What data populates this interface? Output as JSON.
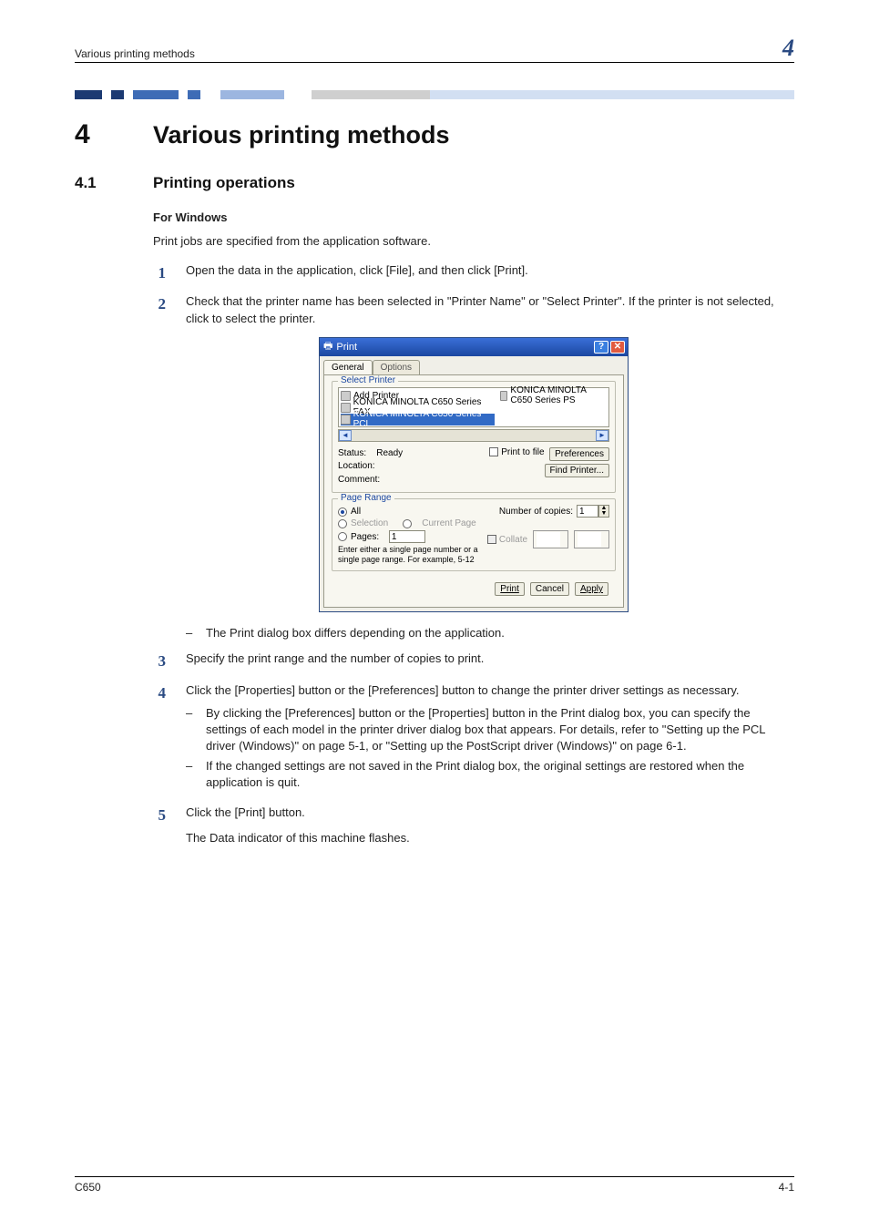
{
  "runhead": {
    "title": "Various printing methods",
    "num": "4"
  },
  "chapter": {
    "num": "4",
    "title": "Various printing methods"
  },
  "section": {
    "num": "4.1",
    "title": "Printing operations"
  },
  "sub_title": "For Windows",
  "intro_para": "Print jobs are specified from the application software.",
  "steps": {
    "s1": {
      "num": "1",
      "text": "Open the data in the application, click [File], and then click [Print]."
    },
    "s2": {
      "num": "2",
      "text": "Check that the printer name has been selected in \"Printer Name\" or \"Select Printer\". If the printer is not selected, click to select the printer."
    },
    "post2_dash": "The Print dialog box differs depending on the application.",
    "s3": {
      "num": "3",
      "text": "Specify the print range and the number of copies to print."
    },
    "s4": {
      "num": "4",
      "text": "Click the [Properties] button or the [Preferences] button to change the printer driver settings as necessary.",
      "d1": "By clicking the [Preferences] button or the [Properties] button in the Print dialog box, you can specify the settings of each model in the printer driver dialog box that appears. For details, refer to \"Setting up the PCL driver (Windows)\" on page 5-1, or \"Setting up the PostScript driver (Windows)\" on page 6-1.",
      "d2": "If the changed settings are not saved in the Print dialog box, the original settings are restored when the application is quit."
    },
    "s5": {
      "num": "5",
      "text": "Click the [Print] button.",
      "after": "The Data indicator of this machine flashes."
    }
  },
  "dialog": {
    "title": "Print",
    "tab_general": "General",
    "tab_options": "Options",
    "group_select": "Select Printer",
    "printers": {
      "add": "Add Printer",
      "fax": "KONICA MINOLTA C650 Series FAX",
      "pcl": "KONICA MINOLTA C650 Series PCL",
      "ps": "KONICA MINOLTA C650 Series PS"
    },
    "status_label": "Status:",
    "status_value": "Ready",
    "location_label": "Location:",
    "comment_label": "Comment:",
    "print_to_file": "Print to file",
    "preferences": "Preferences",
    "find_printer": "Find Printer...",
    "group_page_range": "Page Range",
    "all": "All",
    "selection": "Selection",
    "current_page": "Current Page",
    "pages": "Pages:",
    "pages_value": "1",
    "pages_hint": "Enter either a single page number or a single page range.  For example, 5-12",
    "copies_label": "Number of copies:",
    "copies_value": "1",
    "collate": "Collate",
    "btn_print": "Print",
    "btn_cancel": "Cancel",
    "btn_apply": "Apply"
  },
  "footer": {
    "left": "C650",
    "right": "4-1"
  }
}
